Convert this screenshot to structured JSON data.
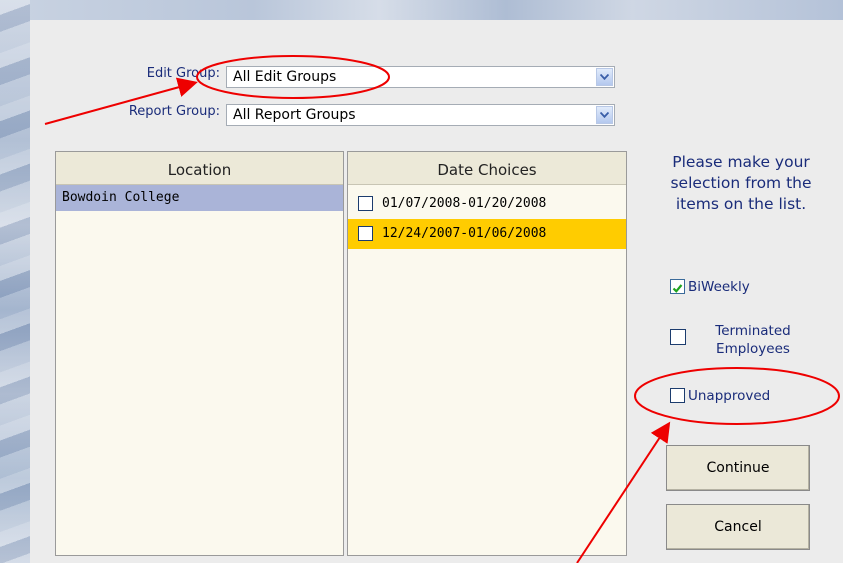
{
  "filters": {
    "edit_group_label": "Edit Group:",
    "edit_group_value": "All Edit Groups",
    "report_group_label": "Report Group:",
    "report_group_value": "All Report Groups"
  },
  "location_list": {
    "header": "Location",
    "items": [
      "Bowdoin College"
    ]
  },
  "date_list": {
    "header": "Date Choices",
    "items": [
      {
        "label": "01/07/2008-01/20/2008",
        "checked": false
      },
      {
        "label": "12/24/2007-01/06/2008",
        "checked": false
      }
    ]
  },
  "instructions": "Please make your selection from the items on the list.",
  "options": {
    "biweekly": {
      "label": "BiWeekly",
      "checked": true
    },
    "terminated": {
      "label_line1": "Terminated",
      "label_line2": "Employees",
      "checked": false
    },
    "unapproved": {
      "label": "Unapproved",
      "checked": false
    }
  },
  "buttons": {
    "continue": "Continue",
    "cancel": "Cancel"
  },
  "colors": {
    "annotation_red": "#ee0000",
    "selected_row": "#ffcc00",
    "location_selected": "#aab4d8",
    "label_blue": "#1a2c7a"
  }
}
